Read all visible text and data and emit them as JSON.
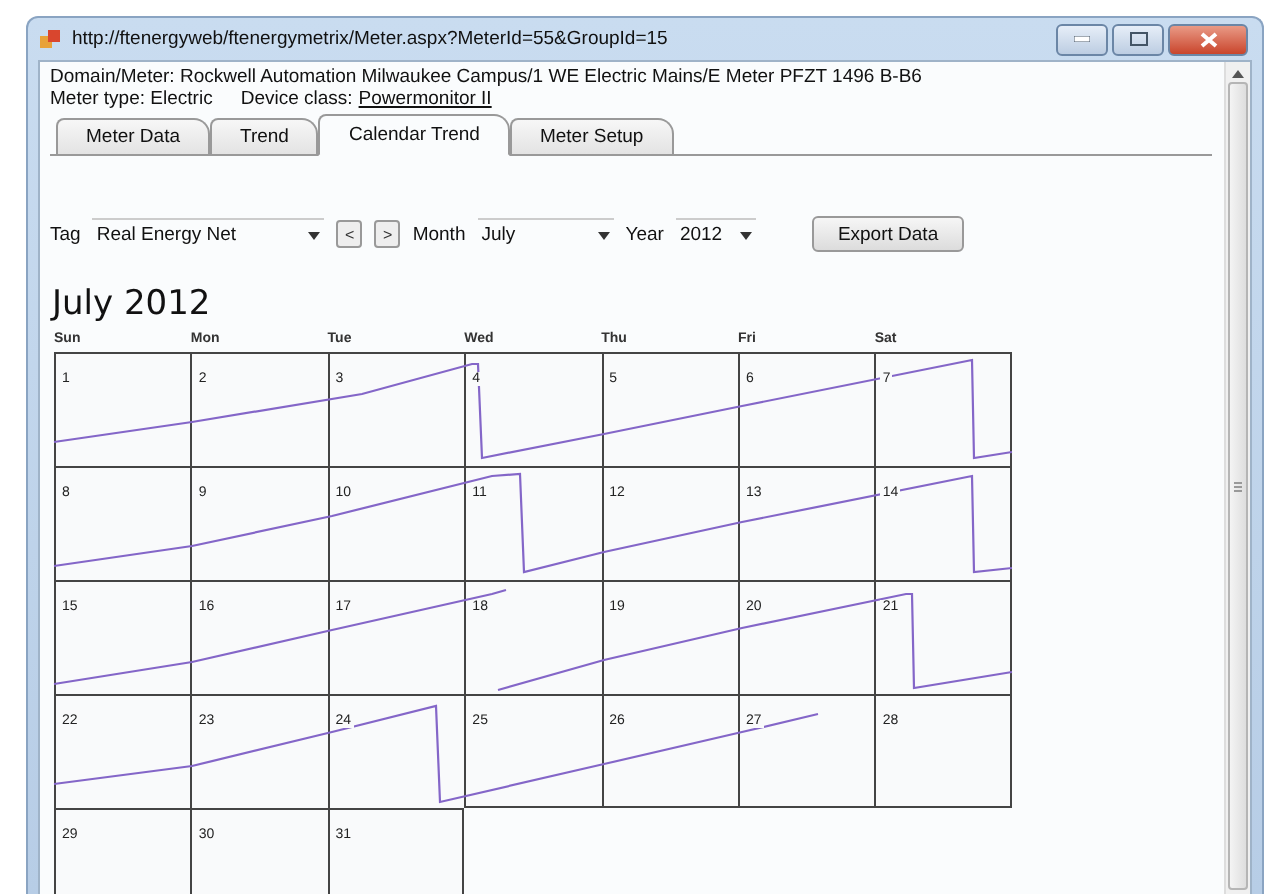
{
  "window": {
    "title": "http://ftenergyweb/ftenergymetrix/Meter.aspx?MeterId=55&GroupId=15"
  },
  "info": {
    "domain_label": "Domain/Meter:",
    "domain_value": "Rockwell Automation Milwaukee Campus/1 WE Electric Mains/E Meter PFZT 1496 B-B6",
    "type_label": "Meter type:",
    "type_value": "Electric",
    "class_label": "Device class:",
    "class_link": "Powermonitor II"
  },
  "tabs": [
    {
      "label": "Meter Data",
      "selected": false
    },
    {
      "label": "Trend",
      "selected": false
    },
    {
      "label": "Calendar Trend",
      "selected": true
    },
    {
      "label": "Meter Setup",
      "selected": false
    }
  ],
  "toolbar": {
    "tag_label": "Tag",
    "tag_value": "Real Energy Net",
    "prev": "<",
    "next": ">",
    "month_label": "Month",
    "month_value": "July",
    "year_label": "Year",
    "year_value": "2012",
    "export": "Export Data"
  },
  "calendar": {
    "title": "July 2012",
    "weekdays": [
      "Sun",
      "Mon",
      "Tue",
      "Wed",
      "Thu",
      "Fri",
      "Sat"
    ],
    "weeks": [
      [
        "1",
        "2",
        "3",
        "4",
        "5",
        "6",
        "7"
      ],
      [
        "8",
        "9",
        "10",
        "11",
        "12",
        "13",
        "14"
      ],
      [
        "15",
        "16",
        "17",
        "18",
        "19",
        "20",
        "21"
      ],
      [
        "22",
        "23",
        "24",
        "25",
        "26",
        "27",
        "28"
      ],
      [
        "29",
        "30",
        "31"
      ]
    ]
  }
}
